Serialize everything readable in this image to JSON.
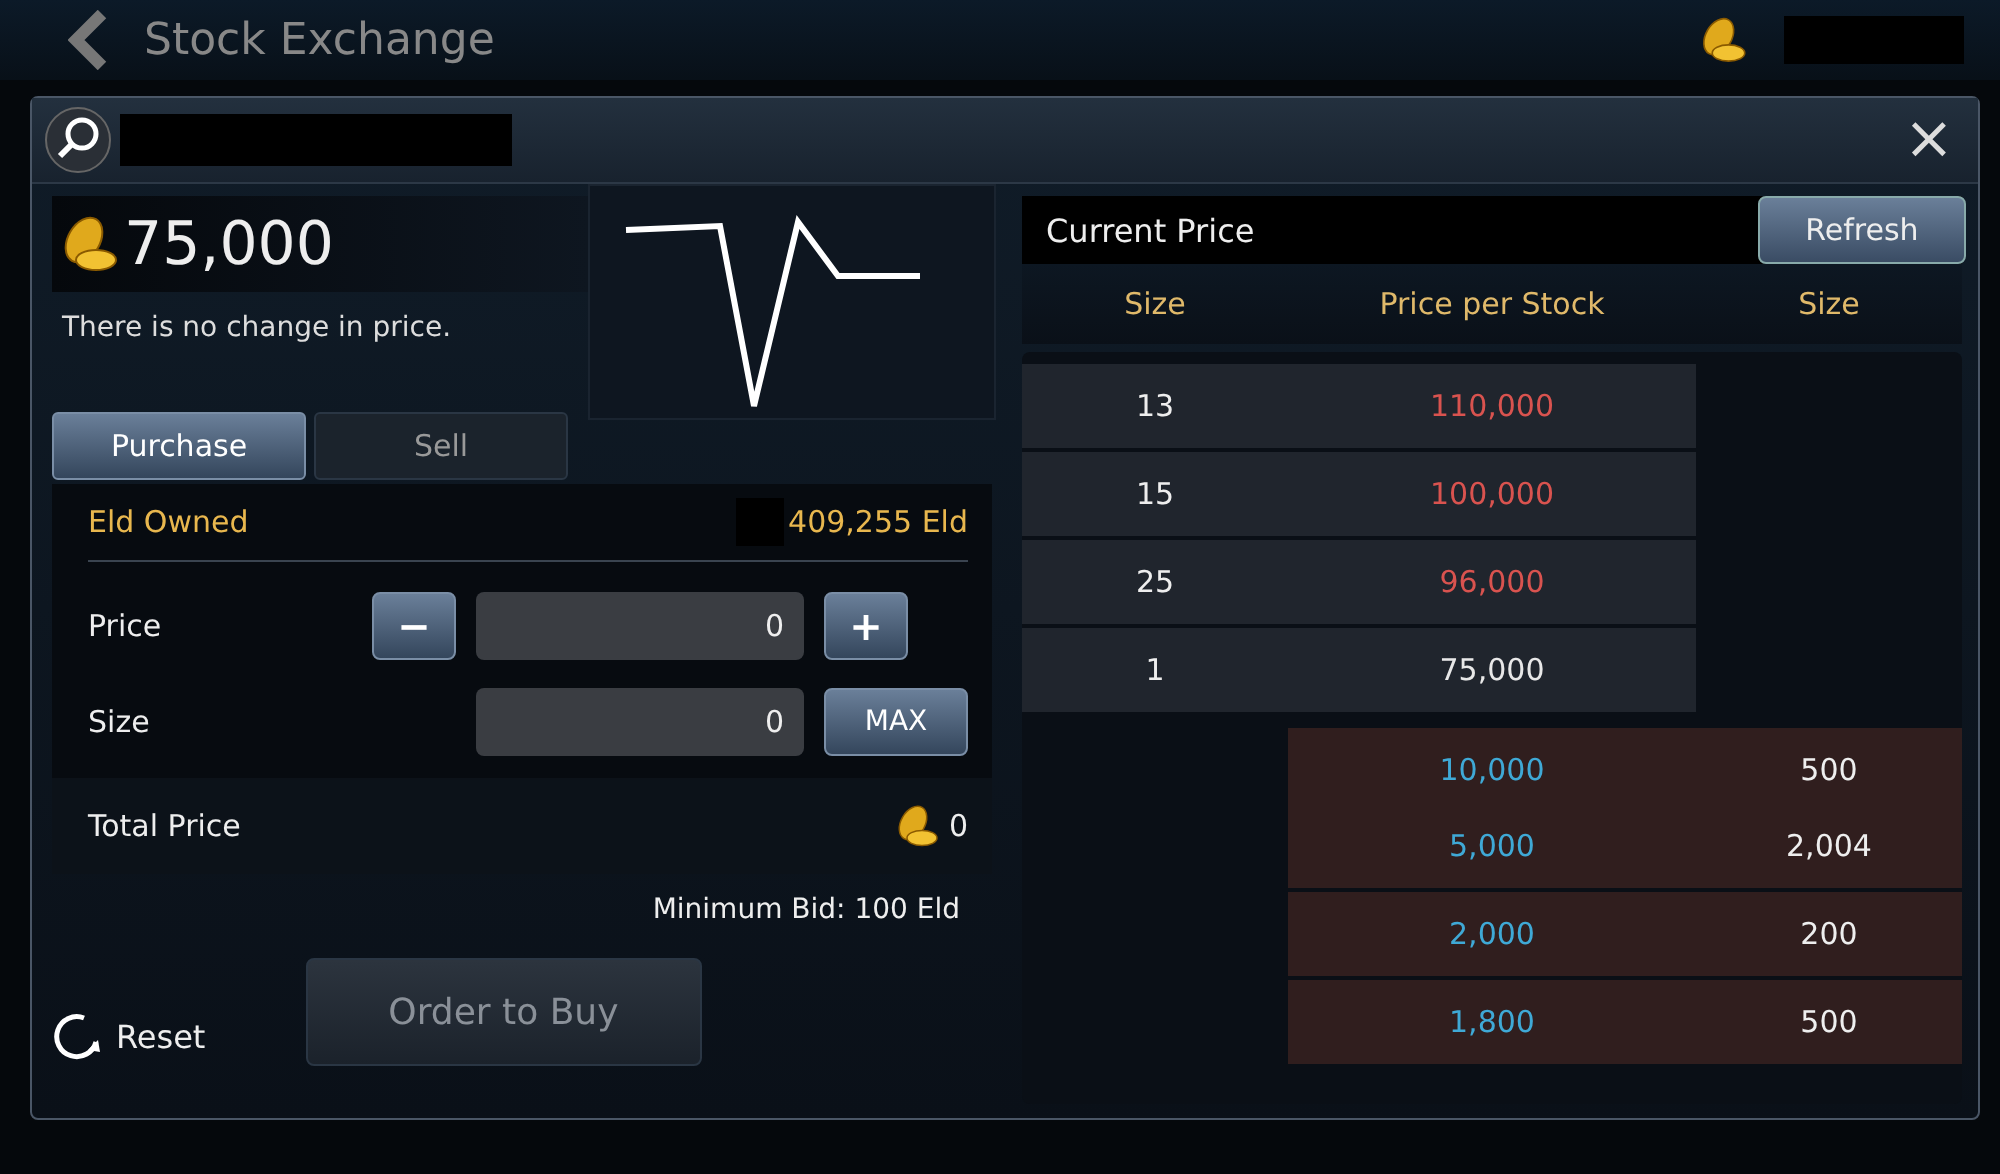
{
  "top_bar": {
    "title": "Stock Exchange"
  },
  "dialog": {
    "close": "×"
  },
  "summary": {
    "price": "75,000",
    "note": "There is no change in price."
  },
  "tabs": [
    {
      "label": "Purchase",
      "selected": true
    },
    {
      "label": "Sell",
      "selected": false
    }
  ],
  "form": {
    "owned_label": "Eld Owned",
    "owned_value": "409,255 Eld",
    "price_label": "Price",
    "price_value": "0",
    "minus": "−",
    "plus": "+",
    "size_label": "Size",
    "size_value": "0",
    "max": "MAX",
    "total_label": "Total Price",
    "total_value": "0",
    "minimum_bid": "Minimum Bid: 100 Eld",
    "order_button": "Order to Buy",
    "reset": "Reset"
  },
  "order_book": {
    "title": "Current Price",
    "refresh": "Refresh",
    "columns": [
      "Size",
      "Price per Stock",
      "Size"
    ],
    "rows": [
      {
        "kind": "ask",
        "size": "13",
        "price": "110,000",
        "color": "#d9534f"
      },
      {
        "kind": "ask",
        "size": "15",
        "price": "100,000",
        "color": "#d9534f"
      },
      {
        "kind": "ask",
        "size": "25",
        "price": "96,000",
        "color": "#d9534f"
      },
      {
        "kind": "ask",
        "size": "1",
        "price": "75,000",
        "color": "#e8e8e8"
      },
      {
        "kind": "bid",
        "size": "500",
        "price": "10,000",
        "color": "#3fa9d6"
      },
      {
        "kind": "bid",
        "size": "2,004",
        "price": "5,000",
        "color": "#3fa9d6"
      },
      {
        "kind": "bid",
        "size": "200",
        "price": "2,000",
        "color": "#3fa9d6"
      },
      {
        "kind": "bid",
        "size": "500",
        "price": "1,800",
        "color": "#3fa9d6"
      }
    ]
  }
}
